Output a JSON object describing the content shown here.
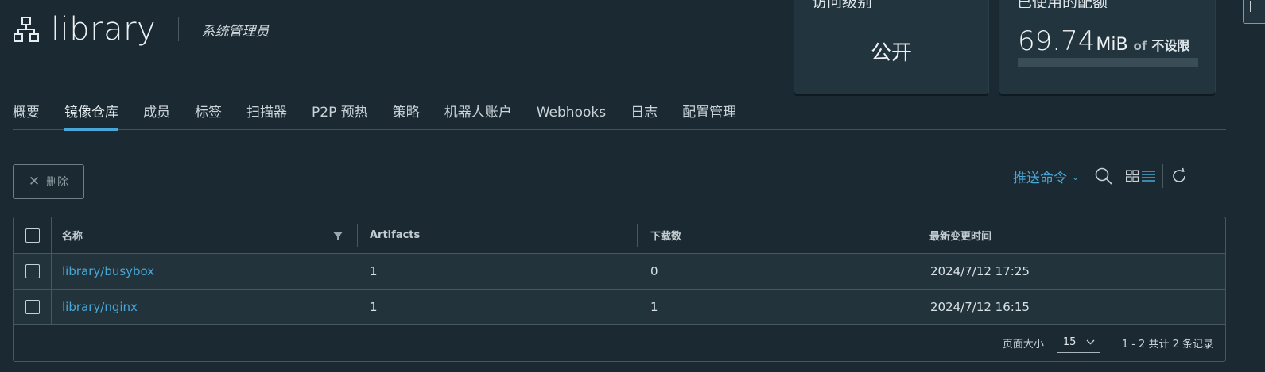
{
  "header": {
    "project_name": "library",
    "role": "系统管理员"
  },
  "cards": {
    "access": {
      "title": "访问级别",
      "value": "公开"
    },
    "quota": {
      "title": "已使用的配额",
      "value": "69.74",
      "unit": "MiB",
      "of": "of",
      "limit": "不设限",
      "usage_fraction": 0
    }
  },
  "tabs": [
    {
      "label": "概要"
    },
    {
      "label": "镜像仓库",
      "active": true
    },
    {
      "label": "成员"
    },
    {
      "label": "标签"
    },
    {
      "label": "扫描器"
    },
    {
      "label": "P2P 预热"
    },
    {
      "label": "策略"
    },
    {
      "label": "机器人账户"
    },
    {
      "label": "Webhooks"
    },
    {
      "label": "日志"
    },
    {
      "label": "配置管理"
    }
  ],
  "actions": {
    "delete_label": "删除",
    "push_command_label": "推送命令"
  },
  "table": {
    "columns": [
      "名称",
      "Artifacts",
      "下载数",
      "最新变更时间"
    ],
    "rows": [
      {
        "name": "library/busybox",
        "artifacts": "1",
        "pulls": "0",
        "updated": "2024/7/12 17:25"
      },
      {
        "name": "library/nginx",
        "artifacts": "1",
        "pulls": "1",
        "updated": "2024/7/12 16:15"
      }
    ]
  },
  "pagination": {
    "page_size_label": "页面大小",
    "page_size": "15",
    "summary": "1 - 2 共计 2 条记录"
  },
  "icons": {
    "project": "project-tree-icon",
    "search": "search-icon",
    "view_toggle": "grid-list-toggle-icon",
    "refresh": "refresh-icon",
    "filter": "filter-icon"
  },
  "colors": {
    "accent": "#49a7d8",
    "background": "#1b2a32",
    "card": "#22343d"
  }
}
